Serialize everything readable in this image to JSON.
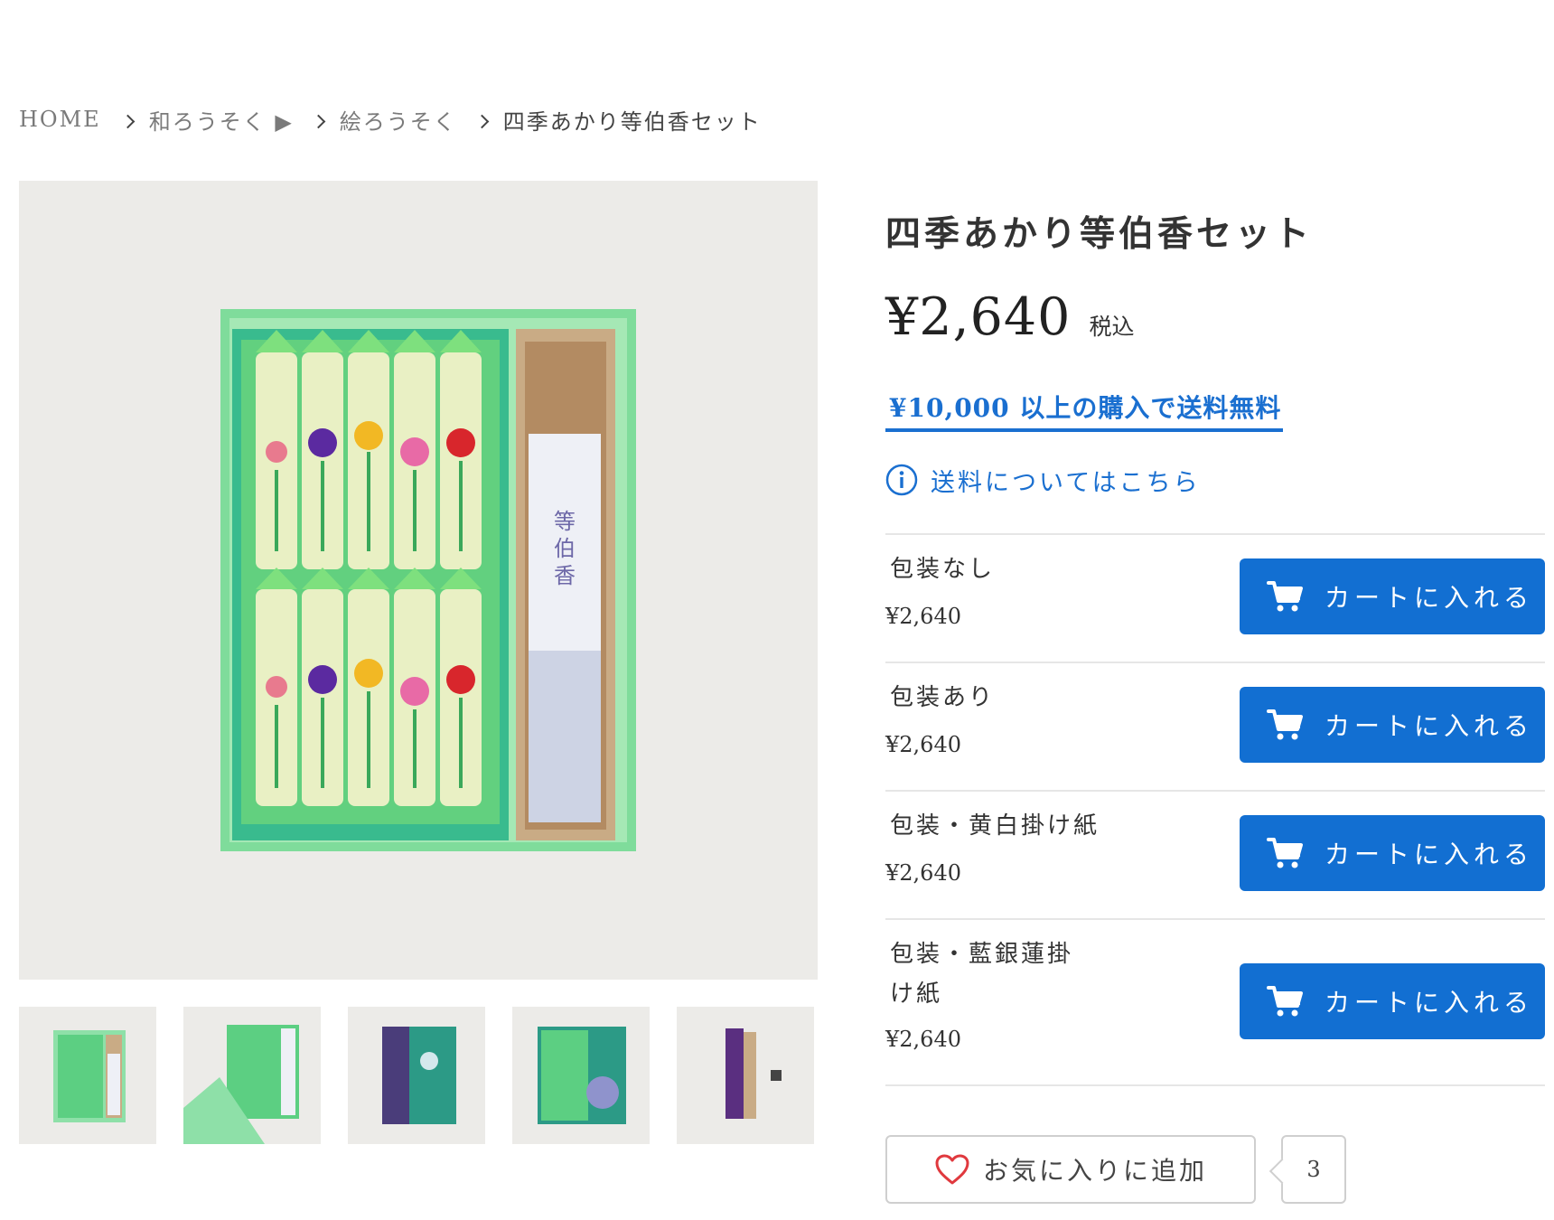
{
  "breadcrumb": {
    "home": "HOME",
    "category": "和ろうそく ▶",
    "subcategory": "絵ろうそく",
    "current": "四季あかり等伯香セット"
  },
  "product": {
    "title": "四季あかり等伯香セット",
    "price": "¥2,640",
    "tax_label": "税込",
    "free_shipping": "¥10,000 以上の購入で送料無料",
    "shipping_info": "送料についてはこちら",
    "incense_label": "等伯香"
  },
  "variants": [
    {
      "name": "包装なし",
      "price": "¥2,640",
      "button": "カートに入れる"
    },
    {
      "name": "包装あり",
      "price": "¥2,640",
      "button": "カートに入れる"
    },
    {
      "name": "包装・黄白掛け紙",
      "price": "¥2,640",
      "button": "カートに入れる"
    },
    {
      "name": "包装・藍銀蓮掛け紙",
      "price": "¥2,640",
      "button": "カートに入れる"
    }
  ],
  "favorite": {
    "label": "お気に入りに追加",
    "count": "3"
  },
  "icons": [
    "chevron-right-icon",
    "info-icon",
    "cart-icon",
    "heart-icon"
  ],
  "colors": {
    "accent": "#126fd2",
    "link": "#1a6fd0",
    "heart": "#e0393e"
  }
}
